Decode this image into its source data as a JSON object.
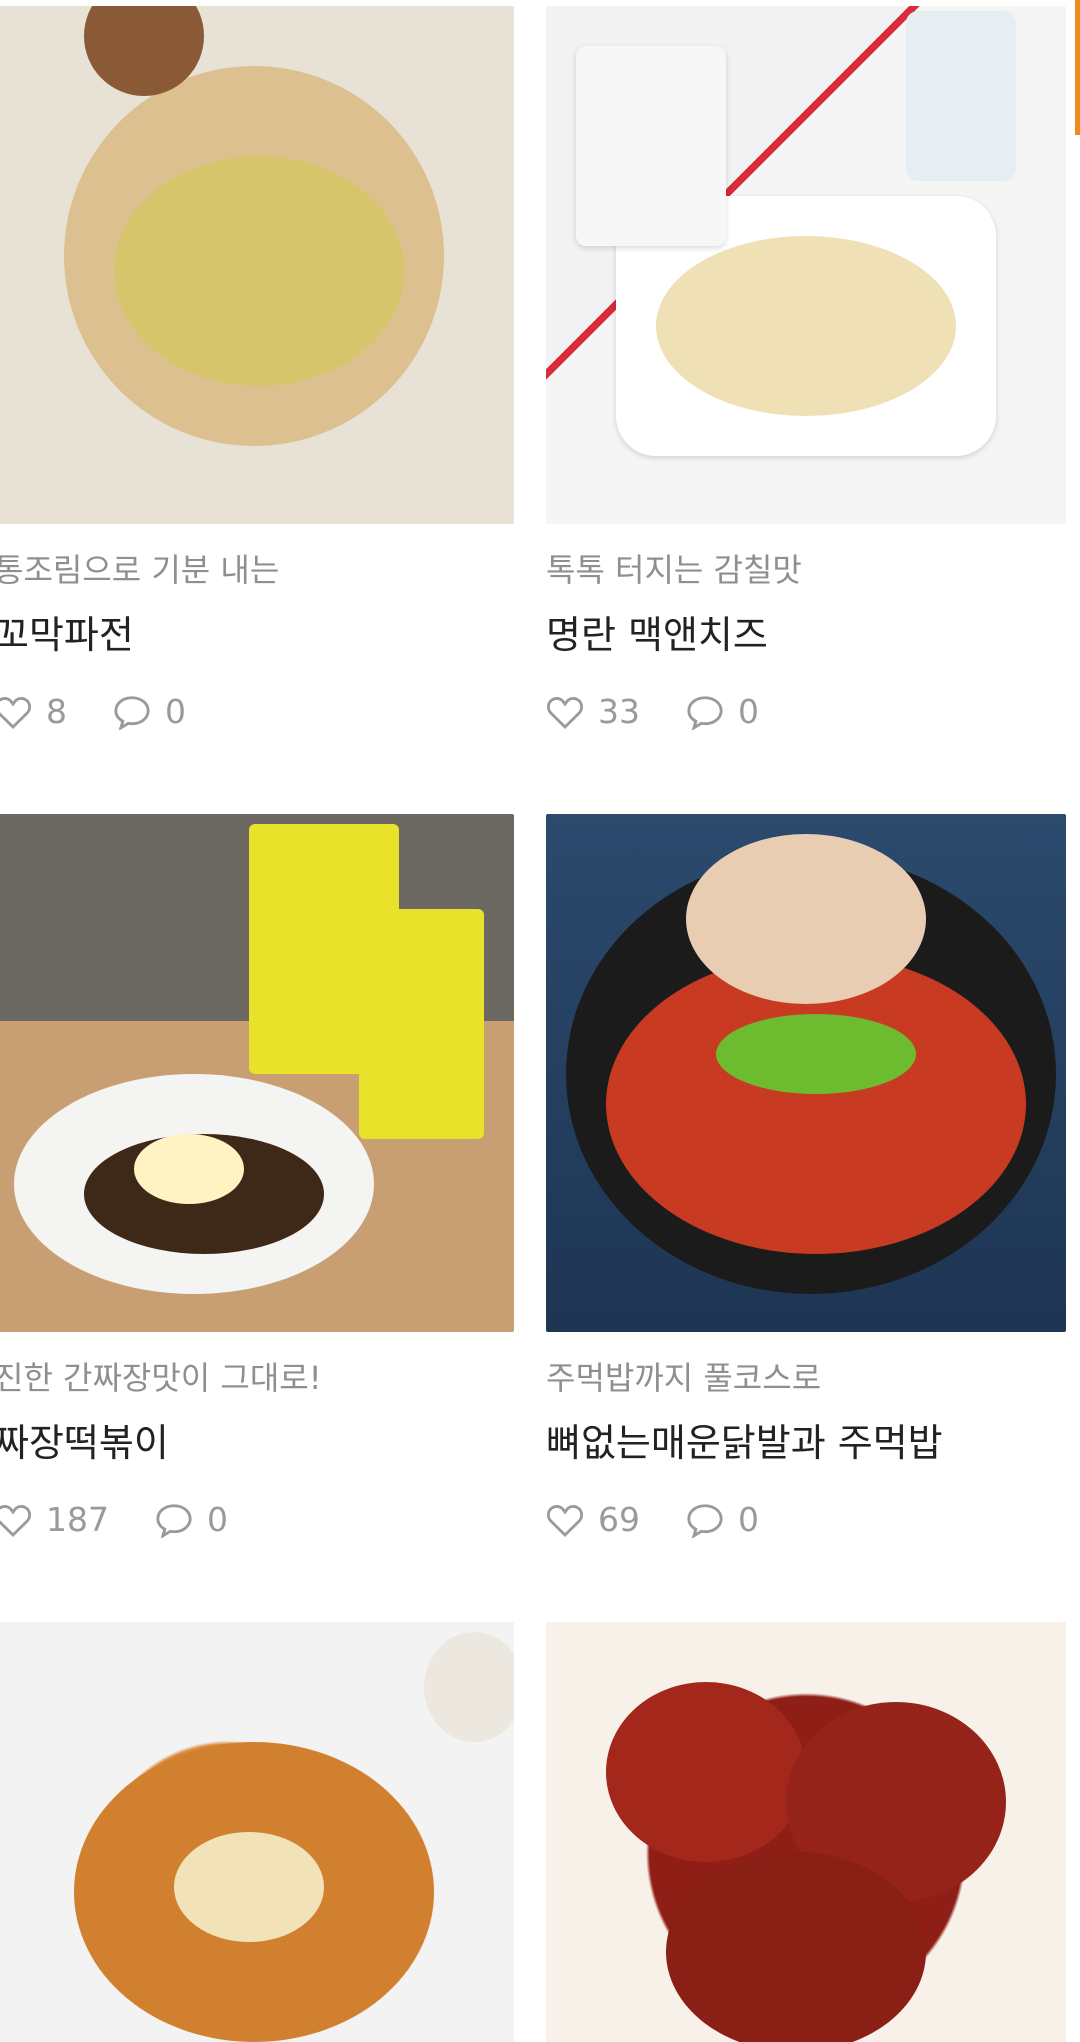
{
  "cards": [
    {
      "subtitle": "통조림으로 기분 내는",
      "title": "꼬막파전",
      "likes": "8",
      "comments": "0",
      "image_icon": "seafood-pancake-photo"
    },
    {
      "subtitle": "톡톡 터지는 감칠맛",
      "title": "명란 맥앤치즈",
      "likes": "33",
      "comments": "0",
      "image_icon": "mac-and-cheese-photo"
    },
    {
      "subtitle": "진한 간짜장맛이 그대로!",
      "title": "짜장떡볶이",
      "likes": "187",
      "comments": "0",
      "image_icon": "jjajang-tteokbokki-photo"
    },
    {
      "subtitle": "주먹밥까지 풀코스로",
      "title": "뼈없는매운닭발과 주먹밥",
      "likes": "69",
      "comments": "0",
      "image_icon": "spicy-chicken-feet-photo"
    },
    {
      "image_icon": "croquette-photo"
    },
    {
      "image_icon": "sweet-spicy-chicken-photo"
    }
  ],
  "colors": {
    "accent": "#f08a1f",
    "subtitle": "#8f8f8f",
    "title": "#222222",
    "meta": "#9a9a9a"
  },
  "icons": {
    "like": "heart-outline-icon",
    "comment": "speech-bubble-icon"
  }
}
